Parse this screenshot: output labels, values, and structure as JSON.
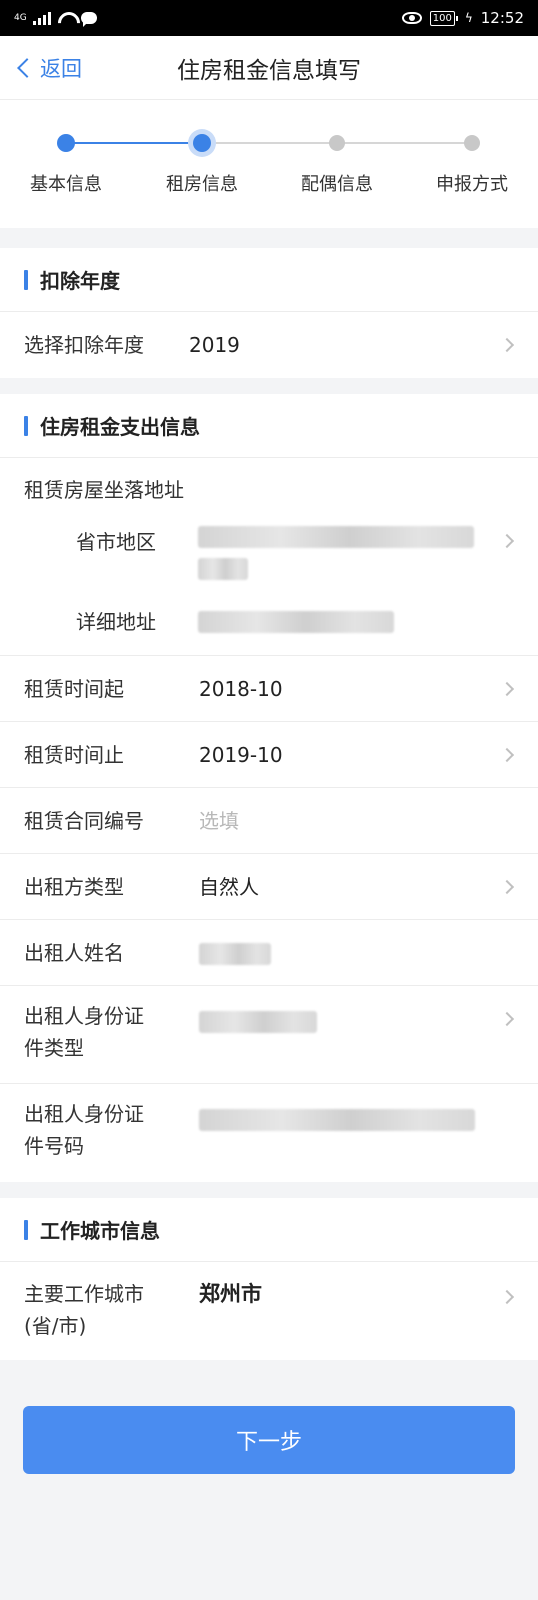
{
  "status_bar": {
    "network": "4G",
    "battery": "100",
    "time": "12:52"
  },
  "nav": {
    "back_label": "返回",
    "title": "住房租金信息填写"
  },
  "steps": [
    {
      "label": "基本信息",
      "state": "done"
    },
    {
      "label": "租房信息",
      "state": "current"
    },
    {
      "label": "配偶信息",
      "state": "pending"
    },
    {
      "label": "申报方式",
      "state": "pending"
    }
  ],
  "section_deduction": {
    "title": "扣除年度",
    "year_label": "选择扣除年度",
    "year_value": "2019"
  },
  "section_rent": {
    "title": "住房租金支出信息",
    "address_label": "租赁房屋坐落地址",
    "region_label": "省市地区",
    "detail_label": "详细地址",
    "start_label": "租赁时间起",
    "start_value": "2018-10",
    "end_label": "租赁时间止",
    "end_value": "2019-10",
    "contract_label": "租赁合同编号",
    "contract_placeholder": "选填",
    "landlord_type_label": "出租方类型",
    "landlord_type_value": "自然人",
    "landlord_name_label": "出租人姓名",
    "id_type_label_line1": "出租人身份证",
    "id_type_label_line2": "件类型",
    "id_number_label_line1": "出租人身份证",
    "id_number_label_line2": "件号码"
  },
  "section_city": {
    "title": "工作城市信息",
    "city_label_line1": "主要工作城市",
    "city_label_line2": "(省/市)",
    "city_value": "郑州市"
  },
  "next_button": "下一步"
}
